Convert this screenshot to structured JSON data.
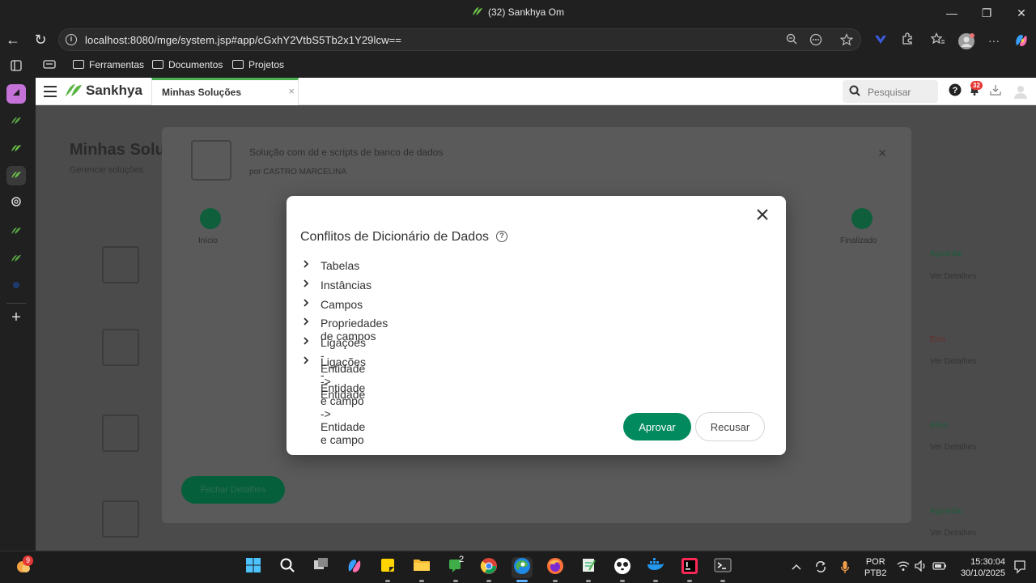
{
  "window": {
    "title": "(32) Sankhya Om",
    "minimize": "—",
    "maximize": "❐",
    "close": "✕"
  },
  "browser": {
    "url": "localhost:8080/mge/system.jsp#app/cGxhY2VtbS5Tb2x1Y29lcw==",
    "back": "←",
    "reload": "↻",
    "more": "···"
  },
  "favorites": [
    "Ferramentas",
    "Documentos",
    "Projetos"
  ],
  "app": {
    "brand": "Sankhya",
    "tab_label": "Minhas Soluções",
    "tab_close": "×",
    "search_placeholder": "Pesquisar",
    "help": "?",
    "notifications": "32"
  },
  "background_page": {
    "title": "Minhas Solu",
    "subtitle": "Gerencie soluções",
    "wizard_title": "Solução com dd e scripts de banco de dados",
    "wizard_by_prefix": "por",
    "wizard_by_name": "CASTRO MARCELINA",
    "step_start": "Início",
    "step_end": "Finalizado",
    "wizard_button": "Fechar Detalhes",
    "statuses": [
      "Aguardar",
      "Ver Detalhes",
      "Erro",
      "Ver Detalhes",
      "Ativo",
      "Ver Detalhes",
      "Aguardar",
      "Ver Detalhes"
    ]
  },
  "modal": {
    "title": "Conflitos de Dicionário de Dados",
    "help_icon": "?",
    "items": [
      "Tabelas",
      "Instâncias",
      "Campos",
      "Propriedades de campos",
      "Ligações - Entidade -> Entidade",
      "Ligações - Entidade e campo -> Entidade e campo"
    ],
    "approve_label": "Aprovar",
    "reject_label": "Recusar"
  },
  "taskbar": {
    "weather_badge": "9",
    "chat_badge": "2",
    "lang_line1": "POR",
    "lang_line2": "PTB2",
    "time": "15:30:04",
    "date": "30/10/2025"
  },
  "colors": {
    "brand_green": "#4caf50",
    "approve_green": "#008a5e",
    "badge_red": "#e53935"
  }
}
